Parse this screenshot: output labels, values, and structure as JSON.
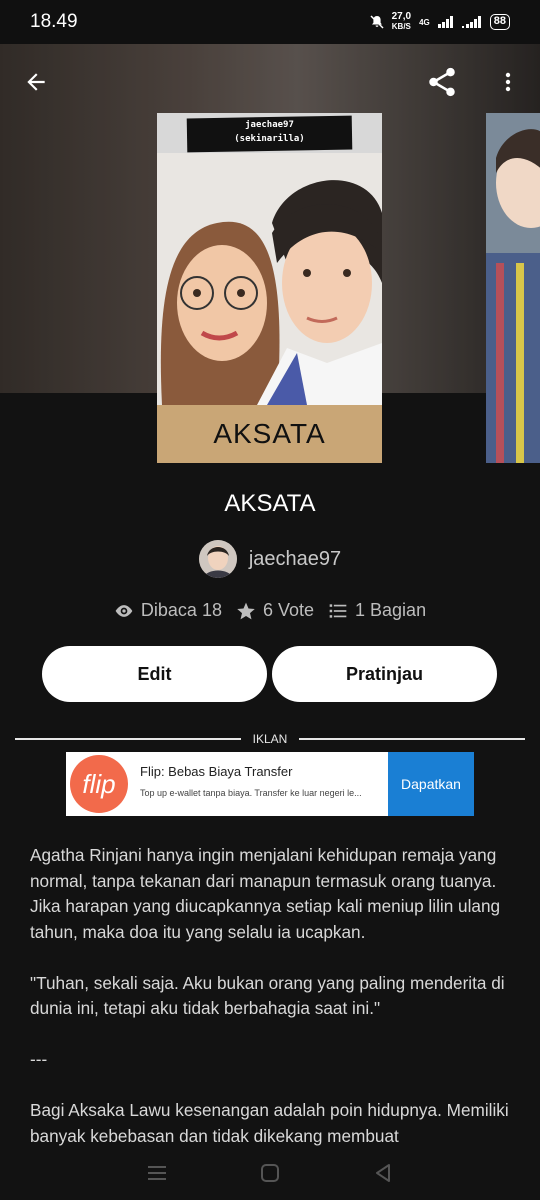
{
  "status_bar": {
    "time": "18.49",
    "net_speed_value": "27,0",
    "net_speed_unit": "KB/S",
    "network_type": "4G",
    "battery": "88"
  },
  "header": {
    "icons": [
      "back-arrow-icon",
      "share-icon",
      "more-vert-icon"
    ]
  },
  "cover": {
    "author_line1": "jaechae97",
    "author_line2": "(sekinarilla)",
    "title": "AKSATA"
  },
  "story": {
    "title": "AKSATA",
    "author": "jaechae97",
    "reads": "Dibaca 18",
    "votes": "6 Vote",
    "parts": "1 Bagian"
  },
  "actions": {
    "edit_label": "Edit",
    "preview_label": "Pratinjau"
  },
  "ad": {
    "label": "IKLAN",
    "logo_text": "flip",
    "title": "Flip: Bebas Biaya Transfer",
    "description": "Top up e-wallet tanpa biaya. Transfer ke luar negeri le...",
    "cta": "Dapatkan"
  },
  "description": {
    "p1": "Agatha Rinjani hanya ingin menjalani kehidupan remaja yang normal, tanpa tekanan dari manapun termasuk orang tuanya. Jika harapan yang diucapkannya setiap kali meniup lilin ulang tahun, maka doa itu yang selalu ia ucapkan.",
    "p2": "\"Tuhan, sekali saja. Aku bukan orang yang paling menderita di dunia ini, tetapi aku tidak berbahagia saat ini.\"",
    "p3": "---",
    "p4": "Bagi Aksaka Lawu kesenangan adalah poin hidupnya. Memiliki banyak kebebasan dan tidak dikekang membuat"
  },
  "colors": {
    "background": "#121212",
    "button_bg": "#ffffff",
    "ad_cta": "#1a7fd4",
    "flip_brand": "#f26a4b"
  }
}
